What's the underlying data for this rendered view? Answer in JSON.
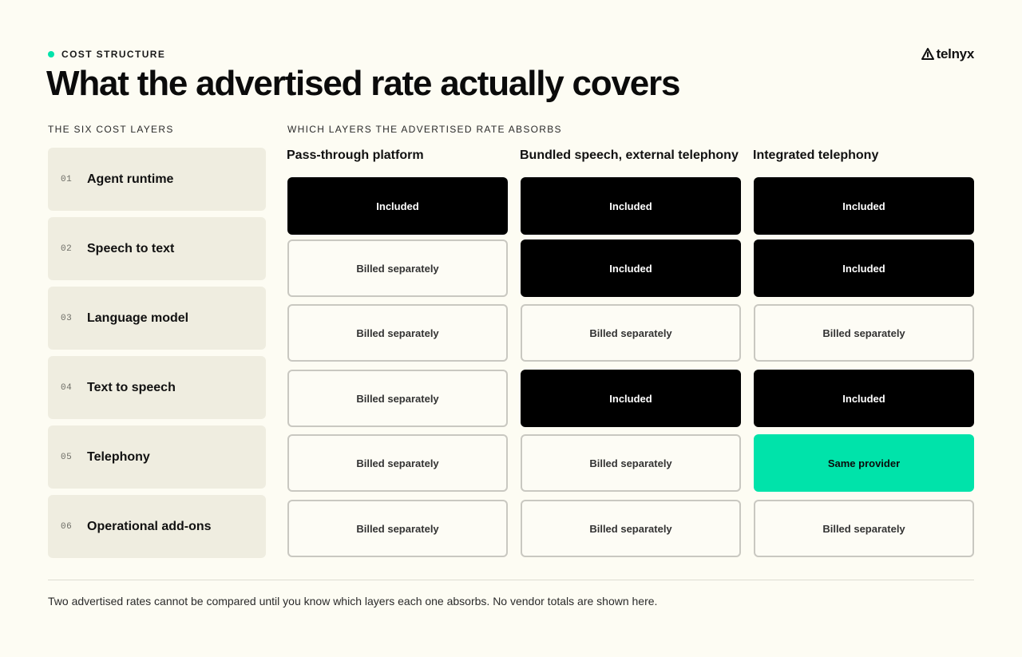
{
  "eyebrow": "COST STRUCTURE",
  "logo_text": "telnyx",
  "title": "What the advertised rate actually covers",
  "layers_label": "THE SIX COST LAYERS",
  "grid_label": "WHICH LAYERS THE ADVERTISED RATE ABSORBS",
  "accent_color": "#00e3aa",
  "layers": [
    {
      "num": "01",
      "name": "Agent runtime"
    },
    {
      "num": "02",
      "name": "Speech to text"
    },
    {
      "num": "03",
      "name": "Language model"
    },
    {
      "num": "04",
      "name": "Text to speech"
    },
    {
      "num": "05",
      "name": "Telephony"
    },
    {
      "num": "06",
      "name": "Operational add-ons"
    }
  ],
  "columns": [
    {
      "name": "Pass-through platform",
      "cells": [
        {
          "status": "included",
          "label": "Included"
        },
        {
          "status": "billed",
          "label": "Billed separately"
        },
        {
          "status": "billed",
          "label": "Billed separately"
        },
        {
          "status": "billed",
          "label": "Billed separately"
        },
        {
          "status": "billed",
          "label": "Billed separately"
        },
        {
          "status": "billed",
          "label": "Billed separately"
        }
      ]
    },
    {
      "name": "Bundled speech, external telephony",
      "cells": [
        {
          "status": "included",
          "label": "Included"
        },
        {
          "status": "included",
          "label": "Included"
        },
        {
          "status": "billed",
          "label": "Billed separately"
        },
        {
          "status": "included",
          "label": "Included"
        },
        {
          "status": "billed",
          "label": "Billed separately"
        },
        {
          "status": "billed",
          "label": "Billed separately"
        }
      ]
    },
    {
      "name": "Integrated telephony",
      "cells": [
        {
          "status": "included",
          "label": "Included"
        },
        {
          "status": "included",
          "label": "Included"
        },
        {
          "status": "billed",
          "label": "Billed separately"
        },
        {
          "status": "included",
          "label": "Included"
        },
        {
          "status": "same",
          "label": "Same provider"
        },
        {
          "status": "billed",
          "label": "Billed separately"
        }
      ]
    }
  ],
  "footnote": "Two advertised rates cannot be compared until you know which layers each one absorbs. No vendor totals are shown here."
}
